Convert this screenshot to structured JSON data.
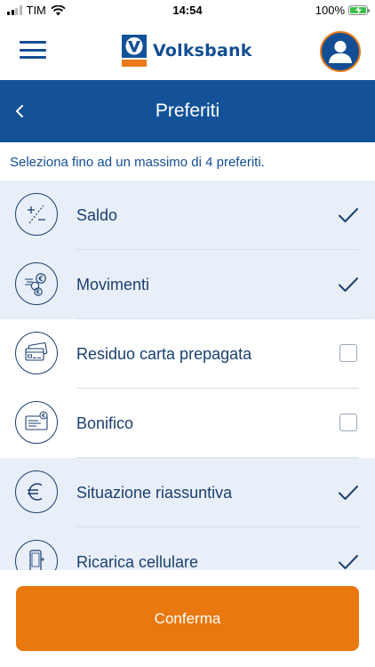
{
  "status_bar": {
    "carrier": "TIM",
    "time": "14:54",
    "battery": "100%",
    "battery_level": 1.0
  },
  "header": {
    "menu_icon": "hamburger-menu-icon",
    "brand_name": "Volksbank",
    "profile_icon": "user-avatar-icon"
  },
  "title_bar": {
    "back_icon": "chevron-left-icon",
    "title": "Preferiti"
  },
  "instructions": "Seleziona fino ad un massimo di 4 preferiti.",
  "favorites": [
    {
      "label": "Saldo",
      "icon": "plus-minus-icon",
      "selected": true
    },
    {
      "label": "Movimenti",
      "icon": "coins-movement-icon",
      "selected": true
    },
    {
      "label": "Residuo carta prepagata",
      "icon": "prepaid-cards-icon",
      "selected": false
    },
    {
      "label": "Bonifico",
      "icon": "transfer-euro-icon",
      "selected": false
    },
    {
      "label": "Situazione riassuntiva",
      "icon": "euro-icon",
      "selected": true
    },
    {
      "label": "Ricarica cellulare",
      "icon": "mobile-phone-icon",
      "selected": true
    }
  ],
  "footer": {
    "confirm_label": "Conferma"
  },
  "colors": {
    "brand_blue": "#135298",
    "accent_orange": "#e8780f",
    "selected_row": "#e9eff8",
    "text_dark_blue": "#1a3f70",
    "battery_green": "#3cc24a"
  }
}
